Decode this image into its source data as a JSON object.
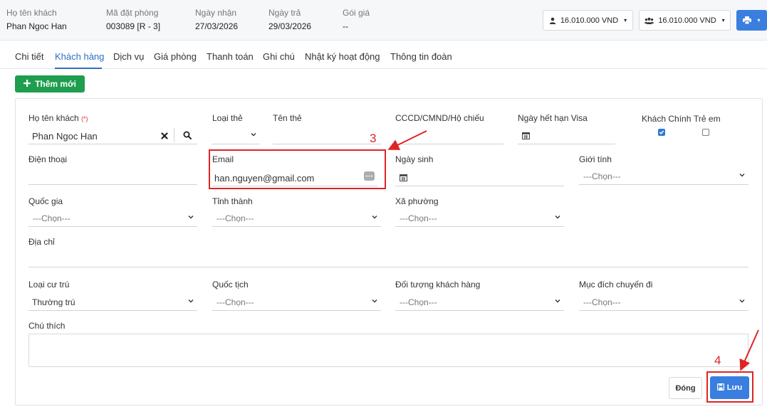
{
  "header": {
    "guest_label": "Họ tên khách",
    "guest_value": "Phan Ngoc Han",
    "booking_label": "Mã đặt phòng",
    "booking_value": "003089 [R - 3]",
    "checkin_label": "Ngày nhận",
    "checkin_value": "27/03/2026",
    "checkout_label": "Ngày trả",
    "checkout_value": "29/03/2026",
    "rate_label": "Gói giá",
    "rate_value": "--",
    "amount_personal": "16.010.000 VND",
    "amount_group": "16.010.000 VND"
  },
  "tabs": [
    {
      "label": "Chi tiết"
    },
    {
      "label": "Khách hàng"
    },
    {
      "label": "Dịch vụ"
    },
    {
      "label": "Giá phòng"
    },
    {
      "label": "Thanh toán"
    },
    {
      "label": "Ghi chú"
    },
    {
      "label": "Nhật ký hoạt động"
    },
    {
      "label": "Thông tin đoàn"
    }
  ],
  "active_tab": "Khách hàng",
  "add_button": "Thêm mới",
  "form": {
    "guest_name_label": "Họ tên khách",
    "required_mark": "(*)",
    "guest_name_value": "Phan Ngoc Han",
    "card_type_label": "Loại thẻ",
    "card_name_label": "Tên thẻ",
    "id_label": "CCCD/CMND/Hộ chiếu",
    "visa_label": "Ngày hết hạn Visa",
    "main_guest_label": "Khách Chính",
    "main_guest_checked": true,
    "child_label": "Trẻ em",
    "child_checked": false,
    "phone_label": "Điện thoại",
    "email_label": "Email",
    "email_value": "han.nguyen@gmail.com",
    "dob_label": "Ngày sinh",
    "gender_label": "Giới tính",
    "gender_value": "---Chọn---",
    "country_label": "Quốc gia",
    "country_value": "---Chọn---",
    "province_label": "Tỉnh thành",
    "province_value": "---Chọn---",
    "ward_label": "Xã phường",
    "ward_value": "---Chọn---",
    "address_label": "Địa chỉ",
    "residence_label": "Loại cư trú",
    "residence_value": "Thường trú",
    "nationality_label": "Quốc tịch",
    "nationality_value": "---Chọn---",
    "customer_type_label": "Đối tượng khách hàng",
    "customer_type_value": "---Chọn---",
    "purpose_label": "Mục đích chuyến đi",
    "purpose_value": "---Chọn---",
    "note_label": "Chú thích"
  },
  "buttons": {
    "close": "Đóng",
    "save": "Lưu"
  },
  "annotations": {
    "step3": "3",
    "step4": "4",
    "color": "#e02424"
  },
  "colors": {
    "primary": "#3a7ee0",
    "success": "#1e9e4e",
    "active_tab": "#2d6fc4"
  }
}
